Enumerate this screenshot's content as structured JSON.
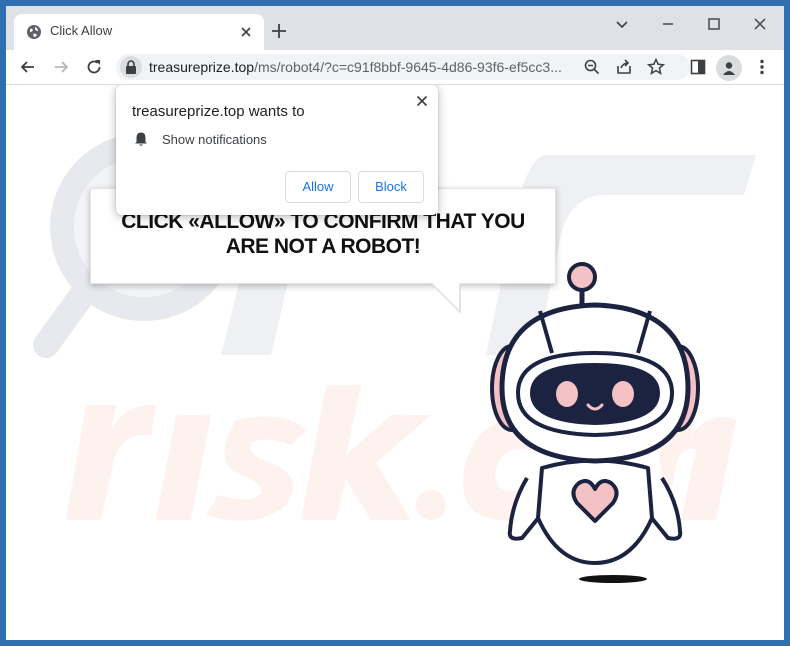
{
  "tab": {
    "title": "Click Allow"
  },
  "address_bar": {
    "domain": "treasureprize.top",
    "path": "/ms/robot4/?c=c91f8bbf-9645-4d86-93f6-ef5cc3..."
  },
  "permission_popup": {
    "title": "treasureprize.top wants to",
    "permission": "Show notifications",
    "allow_label": "Allow",
    "block_label": "Block"
  },
  "page": {
    "bubble_line1": "CLICK «ALLOW» TO CONFIRM THAT YOU",
    "bubble_line2": "ARE NOT A ROBOT!"
  },
  "icons": {
    "tab": [
      "globe-icon",
      "close-icon",
      "plus-icon"
    ],
    "window": [
      "minimize-icon",
      "restore-icon",
      "close-window-icon",
      "tab-search-icon"
    ],
    "toolbar": [
      "back-arrow-icon",
      "forward-arrow-icon",
      "reload-icon",
      "lock-icon",
      "zoom-icon",
      "share-icon",
      "star-icon",
      "side-panel-icon",
      "profile-icon",
      "more-vert-icon"
    ],
    "popup": [
      "bell-icon",
      "close-icon"
    ]
  },
  "colors": {
    "window_frame": "#2f6fb0",
    "titlebar": "#dee1e6",
    "link_blue": "#1a73e8",
    "robot_pink": "#f4c1c4",
    "robot_visor": "#1b2340"
  }
}
